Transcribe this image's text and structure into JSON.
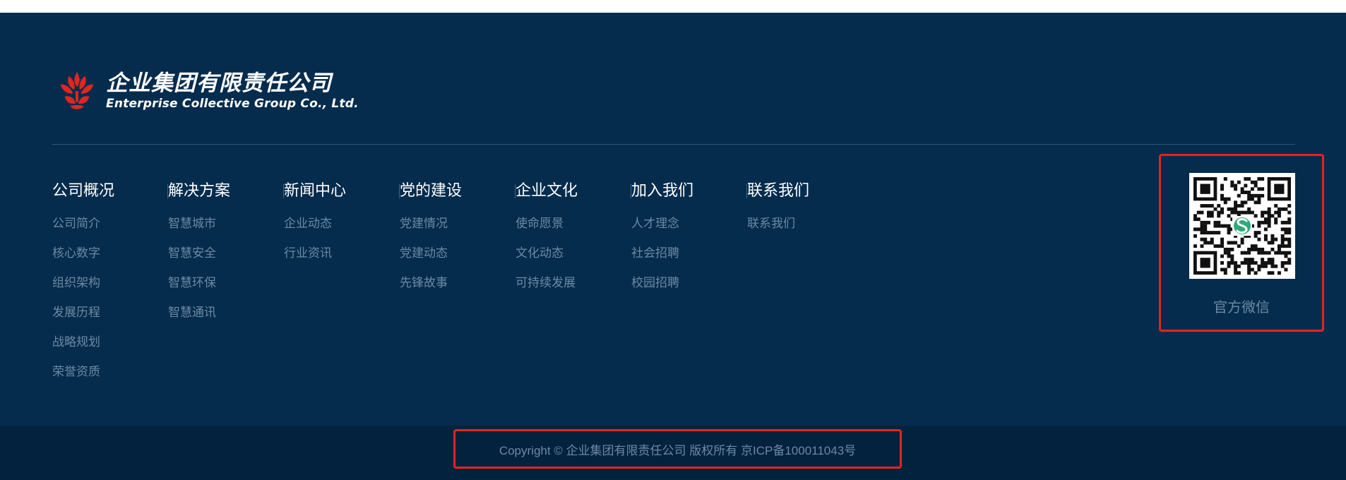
{
  "brand": {
    "name_cn": "企业集团有限责任公司",
    "name_en": "Enterprise Collective Group Co., Ltd.",
    "logo_color": "#e0261f"
  },
  "nav": [
    {
      "title": "公司概况",
      "items": [
        "公司简介",
        "核心数字",
        "组织架构",
        "发展历程",
        "战略规划",
        "荣誉资质"
      ]
    },
    {
      "title": "解决方案",
      "items": [
        "智慧城市",
        "智慧安全",
        "智慧环保",
        "智慧通讯"
      ]
    },
    {
      "title": "新闻中心",
      "items": [
        "企业动态",
        "行业资讯"
      ]
    },
    {
      "title": "党的建设",
      "items": [
        "党建情况",
        "党建动态",
        "先锋故事"
      ]
    },
    {
      "title": "企业文化",
      "items": [
        "使命愿景",
        "文化动态",
        "可持续发展"
      ]
    },
    {
      "title": "加入我们",
      "items": [
        "人才理念",
        "社会招聘",
        "校园招聘"
      ]
    },
    {
      "title": "联系我们",
      "items": [
        "联系我们"
      ]
    }
  ],
  "qr": {
    "label": "官方微信",
    "icon": "qr-code-icon"
  },
  "footer": {
    "copyright": "Copyright © 企业集团有限责任公司 版权所有 京ICP备100011043号"
  },
  "colors": {
    "background": "#052c4d",
    "bottom_bar": "#03223d",
    "link_text": "#6c89a4",
    "highlight": "#e0261f"
  }
}
